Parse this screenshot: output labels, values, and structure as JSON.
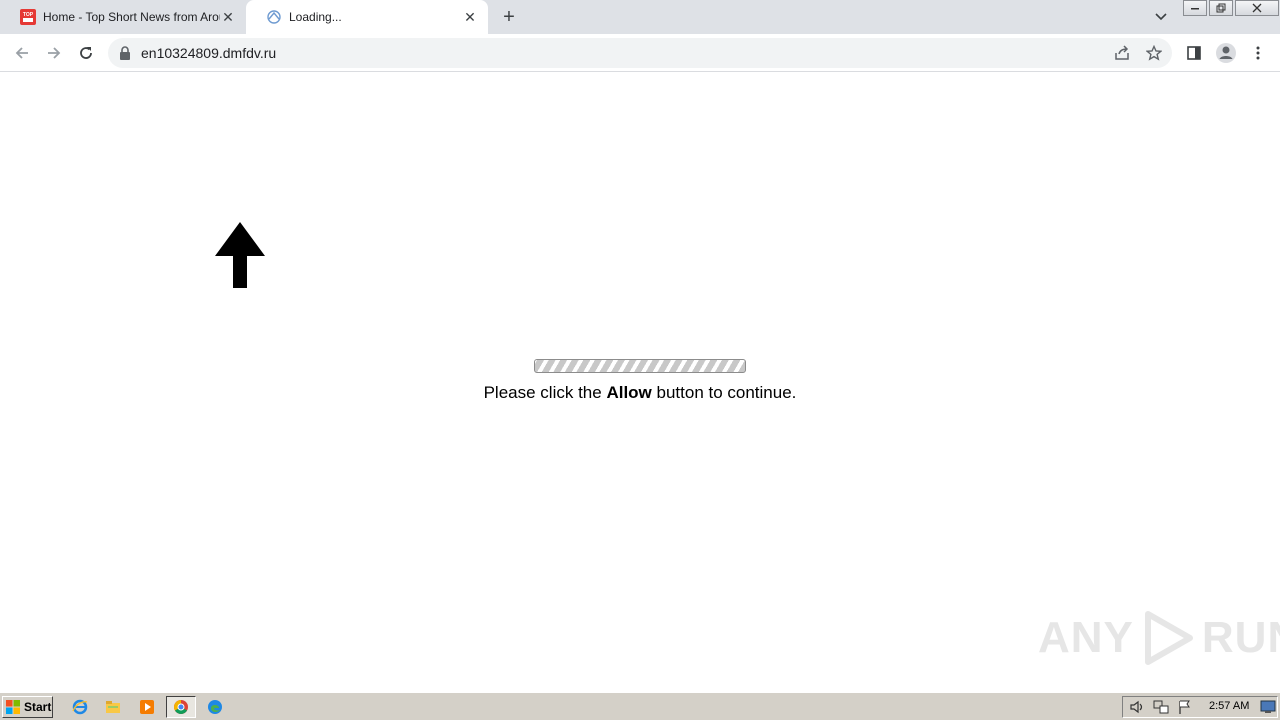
{
  "browser": {
    "tabs": [
      {
        "title": "Home - Top Short News from Around the World",
        "favicon": "top-news-favicon",
        "active": false
      },
      {
        "title": "Loading...",
        "favicon": "loading-favicon",
        "active": true
      }
    ],
    "address": {
      "url": "en10324809.dmfdv.ru"
    }
  },
  "page": {
    "message_before": "Please click the ",
    "message_bold": "Allow",
    "message_after": " button to continue."
  },
  "watermark": {
    "left": "ANY",
    "right": "RUN"
  },
  "taskbar": {
    "start_label": "Start",
    "clock": "2:57 AM"
  },
  "colors": {
    "tabstrip": "#dee1e6",
    "omnibox": "#f1f3f4",
    "taskbar": "#d4d0c8",
    "favicon_red": "#e53935"
  }
}
